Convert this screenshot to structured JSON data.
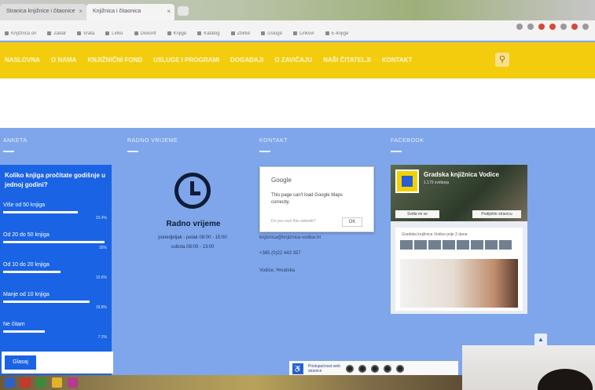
{
  "browser": {
    "tabs": [
      {
        "label": "Stranica knjižnice i čitaonice"
      },
      {
        "label": "Knjižnica i čitaonica"
      }
    ],
    "bookmarks": [
      "Knjižnica on",
      "Zadar",
      "Vrata",
      "Linku",
      "Diskont",
      "Knjige",
      "Katalog",
      "Zbirke",
      "Usluge",
      "Linkovi",
      "E-knjige"
    ]
  },
  "site_nav": {
    "brand": "NASLOVNA",
    "links": [
      "O NAMA",
      "KNJIŽNIČNI FOND",
      "USLUGE I PROGRAMI",
      "DOGAĐAJI",
      "O ZAVIČAJU",
      "NAŠI ČITATELJI",
      "KONTAKT"
    ],
    "search_icon": "search-icon"
  },
  "columns": {
    "poll_heading": "ANKETA",
    "hours_heading": "RADNO VRIJEME",
    "contact_heading": "KONTAKT",
    "facebook_heading": "FACEBOOK"
  },
  "poll": {
    "question": "Koliko knjiga pročitate godišnje u jednoj godini?",
    "options": [
      {
        "label": "Više od 50 knjiga",
        "pct": "23.4%",
        "value": 0.72
      },
      {
        "label": "Od 20 do 50 knjiga",
        "pct": "35%",
        "value": 0.98
      },
      {
        "label": "Od 10 do 20 knjiga",
        "pct": "15.6%",
        "value": 0.55
      },
      {
        "label": "Manje od 10 knjiga",
        "pct": "18.8%",
        "value": 0.83
      },
      {
        "label": "Ne čitam",
        "pct": "7.2%",
        "value": 0.4
      }
    ],
    "vote_label": "Glasaj"
  },
  "hours": {
    "title": "Radno vrijeme",
    "line1": "ponedjeljak - petak 08:00 - 15:00",
    "line2": "subota 08:00 - 13:00"
  },
  "contact": {
    "popup_title": "Google",
    "popup_message": "This page can't load Google Maps correctly.",
    "popup_link": "Do you own this website?",
    "popup_ok": "OK",
    "lines": [
      "knjiznica@knjiznica-vodice.hr",
      "+385 (0)22 443 357",
      "Vodice, Hrvatska"
    ]
  },
  "facebook": {
    "page_name": "Gradska knjižnica Vodice",
    "subtitle": "1.179 sviđanja",
    "like_label": "Sviđa mi se",
    "share_label": "Podijelite stranicu",
    "post_text": "Gradska knjižnica Vodice prije 2 dana"
  },
  "accessibility": {
    "label": "Pristupačnost web stranice"
  },
  "colors": {
    "nav_yellow": "#f4cc0e",
    "body_blue": "#7fa6ea",
    "poll_blue": "#1a63e4"
  }
}
